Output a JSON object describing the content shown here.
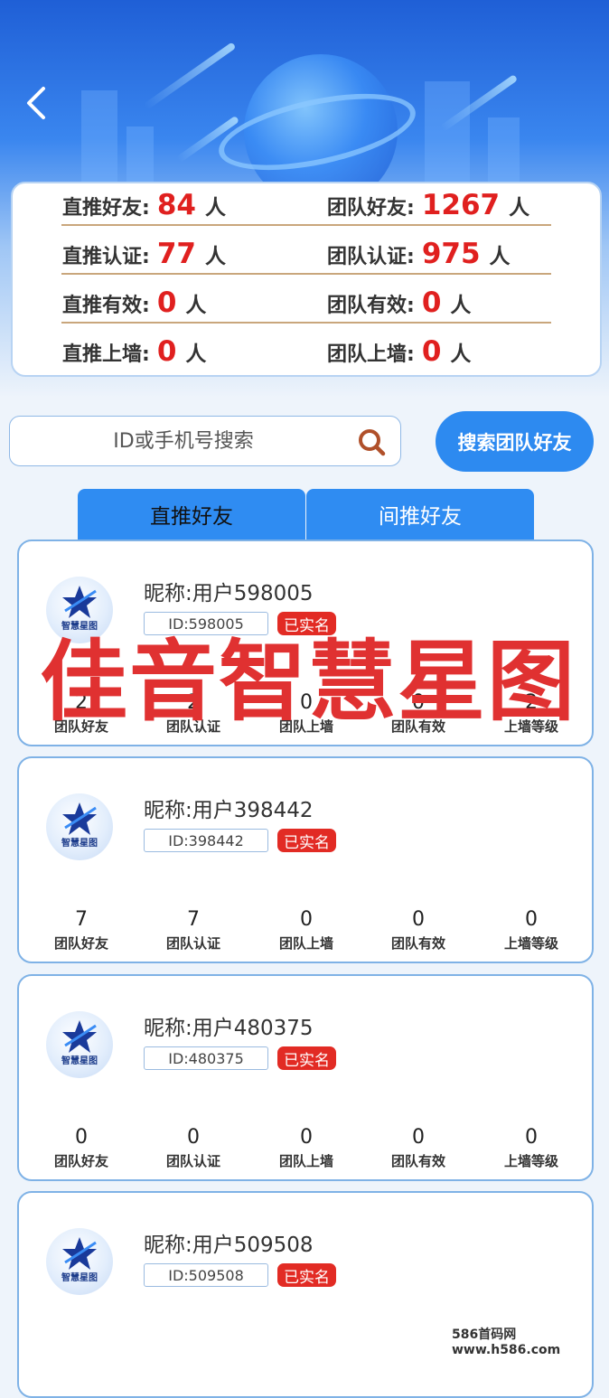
{
  "header": {
    "back_icon": "chevron-left-icon"
  },
  "stats": {
    "direct_friends": {
      "label": "直推好友:",
      "value": "84",
      "unit": "人"
    },
    "team_friends": {
      "label": "团队好友:",
      "value": "1267",
      "unit": "人"
    },
    "direct_verified": {
      "label": "直推认证:",
      "value": "77",
      "unit": "人"
    },
    "team_verified": {
      "label": "团队认证:",
      "value": "975",
      "unit": "人"
    },
    "direct_valid": {
      "label": "直推有效:",
      "value": "0",
      "unit": "人"
    },
    "team_valid": {
      "label": "团队有效:",
      "value": "0",
      "unit": "人"
    },
    "direct_wall": {
      "label": "直推上墙:",
      "value": "0",
      "unit": "人"
    },
    "team_wall": {
      "label": "团队上墙:",
      "value": "0",
      "unit": "人"
    }
  },
  "search": {
    "placeholder": "ID或手机号搜索",
    "button": "搜索团队好友",
    "icon": "search-icon"
  },
  "tabs": [
    {
      "label": "直推好友"
    },
    {
      "label": "间推好友"
    }
  ],
  "stat_labels": [
    "团队好友",
    "团队认证",
    "团队上墙",
    "团队有效",
    "上墙等级"
  ],
  "avatar_text": "智慧星图",
  "members": [
    {
      "nickname": "昵称:用户598005",
      "id": "ID:598005",
      "badge": "已实名",
      "stats": [
        "2",
        "2",
        "0",
        "0",
        "2"
      ]
    },
    {
      "nickname": "昵称:用户398442",
      "id": "ID:398442",
      "badge": "已实名",
      "stats": [
        "7",
        "7",
        "0",
        "0",
        "0"
      ]
    },
    {
      "nickname": "昵称:用户480375",
      "id": "ID:480375",
      "badge": "已实名",
      "stats": [
        "0",
        "0",
        "0",
        "0",
        "0"
      ]
    },
    {
      "nickname": "昵称:用户509508",
      "id": "ID:509508",
      "badge": "已实名",
      "stats": []
    }
  ],
  "watermark": "佳音智慧星图",
  "site_mark": "586首码网 www.h586.com"
}
